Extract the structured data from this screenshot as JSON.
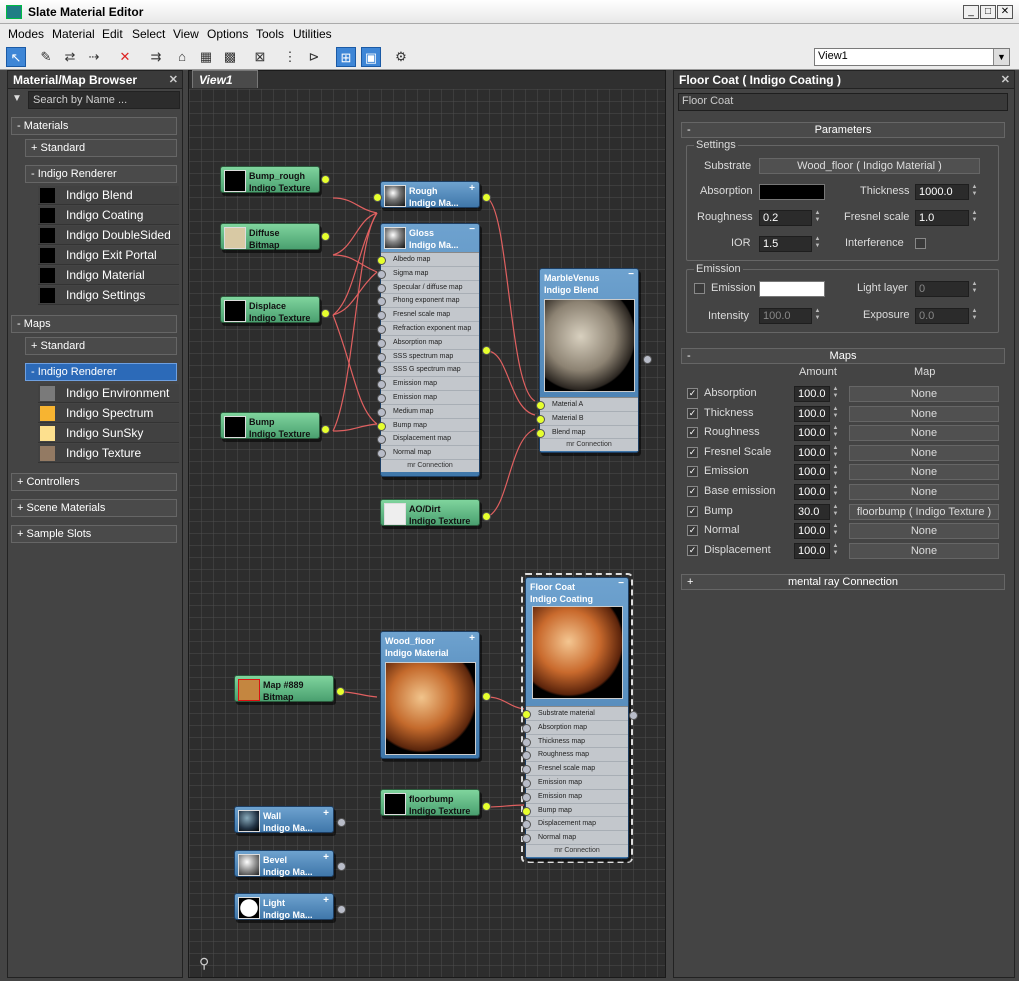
{
  "window": {
    "title": "Slate Material Editor",
    "min_icon": "minimize-icon",
    "max_icon": "maximize-icon",
    "close_icon": "close-icon"
  },
  "menu": [
    "Modes",
    "Material",
    "Edit",
    "Select",
    "View",
    "Options",
    "Tools",
    "Utilities"
  ],
  "view_selector": {
    "value": "View1"
  },
  "browser": {
    "title": "Material/Map Browser",
    "search_placeholder": "Search by Name ...",
    "materials": {
      "label": "- Materials",
      "standard": "+ Standard",
      "renderer": "- Indigo Renderer",
      "items": [
        "Indigo Blend",
        "Indigo Coating",
        "Indigo DoubleSided",
        "Indigo Exit Portal",
        "Indigo Material",
        "Indigo Settings"
      ]
    },
    "maps": {
      "label": "- Maps",
      "standard": "+ Standard",
      "renderer": "- Indigo Renderer",
      "items": [
        {
          "name": "Indigo Environment",
          "color": "#7a7a7a"
        },
        {
          "name": "Indigo Spectrum",
          "color": "#f7b431"
        },
        {
          "name": "Indigo SunSky",
          "color": "#fde08e"
        },
        {
          "name": "Indigo Texture",
          "color": "#937a63"
        }
      ]
    },
    "controllers": "+ Controllers",
    "scene_materials": "+ Scene Materials",
    "sample_slots": "+ Sample Slots"
  },
  "view": {
    "tab": "View1"
  },
  "nodes": {
    "bump_rough": {
      "name": "Bump_rough",
      "type": "Indigo Texture"
    },
    "diffuse": {
      "name": "Diffuse",
      "type": "Bitmap"
    },
    "displace": {
      "name": "Displace",
      "type": "Indigo Texture"
    },
    "bump": {
      "name": "Bump",
      "type": "Indigo Texture"
    },
    "rough": {
      "name": "Rough",
      "type": "Indigo Ma..."
    },
    "gloss": {
      "name": "Gloss",
      "type": "Indigo Ma...",
      "slots": [
        "Albedo map",
        "Sigma map",
        "Specular / diffuse map",
        "Phong exponent map",
        "Fresnel scale map",
        "Refraction exponent map",
        "Absorption map",
        "SSS spectrum map",
        "SSS G spectrum map",
        "Emission map",
        "Emission map",
        "Medium map",
        "Bump map",
        "Displacement map",
        "Normal map"
      ],
      "footer": "mr Connection"
    },
    "aodirt": {
      "name": "AO/Dirt",
      "type": "Indigo Texture"
    },
    "marble": {
      "name": "MarbleVenus",
      "type": "Indigo Blend",
      "slots": [
        "Material A",
        "Material B",
        "Blend map"
      ],
      "footer": "mr Connection"
    },
    "map889": {
      "name": "Map #889",
      "type": "Bitmap"
    },
    "wood": {
      "name": "Wood_floor",
      "type": "Indigo Material"
    },
    "floorbump": {
      "name": "floorbump",
      "type": "Indigo Texture"
    },
    "floorcoat": {
      "name": "Floor Coat",
      "type": "Indigo Coating",
      "slots": [
        "Substrate material",
        "Absorption map",
        "Thickness map",
        "Roughness map",
        "Fresnel scale map",
        "Emission map",
        "Emission map",
        "Bump map",
        "Displacement map",
        "Normal map"
      ],
      "footer": "mr Connection"
    },
    "wall": {
      "name": "Wall",
      "type": "Indigo Ma..."
    },
    "bevel": {
      "name": "Bevel",
      "type": "Indigo Ma..."
    },
    "light": {
      "name": "Light",
      "type": "Indigo Ma..."
    }
  },
  "props": {
    "title": "Floor Coat  ( Indigo Coating )",
    "name_field": "Floor Coat",
    "parameters": {
      "header": "Parameters",
      "settings": "Settings",
      "substrate_label": "Substrate",
      "substrate_value": "Wood_floor  ( Indigo Material )",
      "absorption": "Absorption",
      "thickness": "Thickness",
      "thickness_value": "1000.0",
      "roughness": "Roughness",
      "roughness_value": "0.2",
      "fresnel": "Fresnel scale",
      "fresnel_value": "1.0",
      "ior": "IOR",
      "ior_value": "1.5",
      "interference": "Interference",
      "emission_group": "Emission",
      "emission": "Emission",
      "light_layer": "Light layer",
      "light_layer_value": "0",
      "intensity": "Intensity",
      "intensity_value": "100.0",
      "exposure": "Exposure",
      "exposure_value": "0.0"
    },
    "maps": {
      "header": "Maps",
      "amount_col": "Amount",
      "map_col": "Map",
      "rows": [
        {
          "name": "Absorption",
          "amount": "100.0",
          "map": "None"
        },
        {
          "name": "Thickness",
          "amount": "100.0",
          "map": "None"
        },
        {
          "name": "Roughness",
          "amount": "100.0",
          "map": "None"
        },
        {
          "name": "Fresnel Scale",
          "amount": "100.0",
          "map": "None"
        },
        {
          "name": "Emission",
          "amount": "100.0",
          "map": "None"
        },
        {
          "name": "Base emission",
          "amount": "100.0",
          "map": "None"
        },
        {
          "name": "Bump",
          "amount": "30.0",
          "map": "floorbump  ( Indigo Texture )"
        },
        {
          "name": "Normal",
          "amount": "100.0",
          "map": "None"
        },
        {
          "name": "Displacement",
          "amount": "100.0",
          "map": "None"
        }
      ]
    },
    "mr_connection": "mental ray Connection"
  },
  "colors": {
    "node_green": "#5fb882",
    "node_blue": "#5a8fc0",
    "wire": "#e06060",
    "port": "#e6ff2e",
    "selection": "#2c6ab8"
  }
}
